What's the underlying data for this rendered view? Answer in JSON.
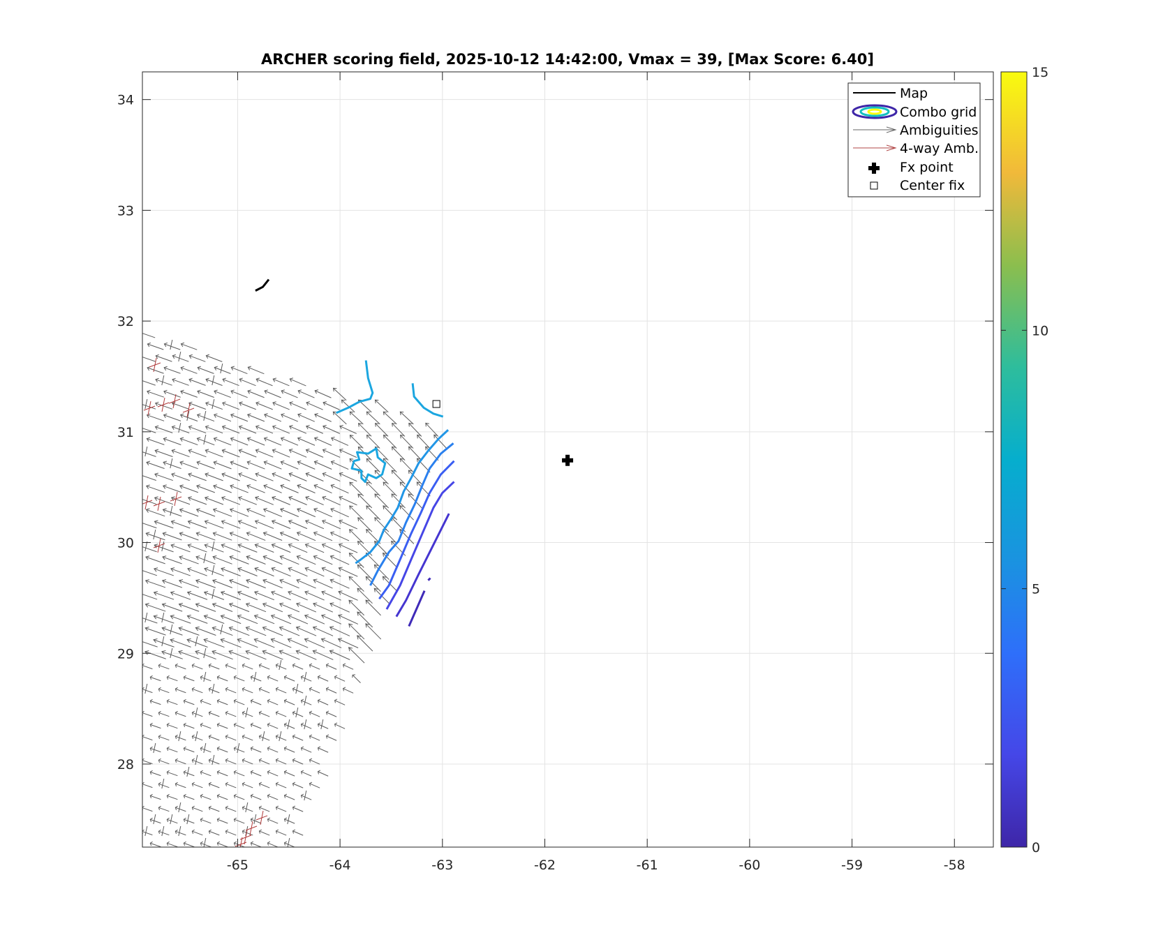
{
  "chart_data": {
    "type": "contour",
    "title": "ARCHER scoring field, 2025-10-12 14:42:00, Vmax = 39, [Max Score: 6.40]",
    "xlabel": "",
    "ylabel": "",
    "xlim": [
      -65.93,
      -57.62
    ],
    "ylim": [
      27.25,
      34.25
    ],
    "grid": true,
    "xticks": [
      -65,
      -64,
      -63,
      -62,
      -61,
      -60,
      -59,
      -58
    ],
    "yticks": [
      28,
      29,
      30,
      31,
      32,
      33,
      34
    ],
    "colorbar": {
      "min": 0,
      "max": 15,
      "ticks": [
        0,
        5,
        10,
        15
      ],
      "colormap": "parula"
    },
    "legend": {
      "placement": "top-right",
      "entries": [
        "Map",
        "Combo grid",
        "Ambiguities",
        "4-way Amb.",
        "Fx point",
        "Center fix"
      ]
    },
    "map_coast": [
      [
        -64.826,
        32.274
      ],
      [
        -64.754,
        32.308
      ],
      [
        -64.696,
        32.375
      ]
    ],
    "fx_point": {
      "lon": -61.778,
      "lat": 30.742
    },
    "center_fix": {
      "lon": -63.059,
      "lat": 31.251
    },
    "contours": [
      {
        "level": 5.8,
        "color": "#1ba6e0",
        "points": [
          [
            -63.747,
            31.645
          ],
          [
            -63.726,
            31.485
          ],
          [
            -63.682,
            31.351
          ],
          [
            -63.704,
            31.298
          ],
          [
            -63.812,
            31.271
          ],
          [
            -63.921,
            31.217
          ],
          [
            -64.037,
            31.171
          ]
        ]
      },
      {
        "level": 5.8,
        "color": "#1ba6e0",
        "points": [
          [
            -63.291,
            31.438
          ],
          [
            -63.277,
            31.318
          ],
          [
            -63.182,
            31.217
          ],
          [
            -63.088,
            31.164
          ],
          [
            -62.994,
            31.137
          ]
        ]
      },
      {
        "level": 5.8,
        "color": "#1ba6e0",
        "closed": true,
        "points": [
          [
            -63.834,
            30.816
          ],
          [
            -63.726,
            30.803
          ],
          [
            -63.646,
            30.849
          ],
          [
            -63.631,
            30.769
          ],
          [
            -63.559,
            30.716
          ],
          [
            -63.588,
            30.615
          ],
          [
            -63.646,
            30.582
          ],
          [
            -63.726,
            30.615
          ],
          [
            -63.755,
            30.548
          ],
          [
            -63.791,
            30.582
          ],
          [
            -63.791,
            30.649
          ],
          [
            -63.885,
            30.669
          ],
          [
            -63.863,
            30.736
          ],
          [
            -63.812,
            30.749
          ]
        ]
      },
      {
        "level": 5.2,
        "color": "#2196e6",
        "points": [
          [
            -62.944,
            31.017
          ],
          [
            -63.038,
            30.936
          ],
          [
            -63.139,
            30.829
          ],
          [
            -63.233,
            30.716
          ],
          [
            -63.306,
            30.582
          ],
          [
            -63.378,
            30.462
          ],
          [
            -63.436,
            30.314
          ],
          [
            -63.501,
            30.214
          ],
          [
            -63.573,
            30.114
          ],
          [
            -63.617,
            30.013
          ],
          [
            -63.704,
            29.913
          ],
          [
            -63.798,
            29.846
          ],
          [
            -63.849,
            29.813
          ]
        ]
      },
      {
        "level": 4.6,
        "color": "#2a80ee",
        "points": [
          [
            -62.893,
            30.896
          ],
          [
            -63.016,
            30.803
          ],
          [
            -63.125,
            30.669
          ],
          [
            -63.197,
            30.515
          ],
          [
            -63.269,
            30.348
          ],
          [
            -63.356,
            30.181
          ],
          [
            -63.429,
            30.013
          ],
          [
            -63.523,
            29.913
          ],
          [
            -63.631,
            29.746
          ],
          [
            -63.704,
            29.612
          ]
        ]
      },
      {
        "level": 3.5,
        "color": "#3a5ef2",
        "points": [
          [
            -62.886,
            30.736
          ],
          [
            -63.016,
            30.615
          ],
          [
            -63.125,
            30.448
          ],
          [
            -63.211,
            30.268
          ],
          [
            -63.306,
            30.08
          ],
          [
            -63.414,
            29.846
          ],
          [
            -63.523,
            29.612
          ],
          [
            -63.617,
            29.492
          ]
        ]
      },
      {
        "level": 2.3,
        "color": "#4646e6",
        "points": [
          [
            -62.886,
            30.549
          ],
          [
            -63.001,
            30.448
          ],
          [
            -63.088,
            30.314
          ],
          [
            -63.197,
            30.08
          ],
          [
            -63.306,
            29.846
          ],
          [
            -63.414,
            29.612
          ],
          [
            -63.545,
            29.398
          ]
        ]
      },
      {
        "level": 1.2,
        "color": "#4535d0",
        "points": [
          [
            -62.936,
            30.261
          ],
          [
            -63.088,
            29.98
          ],
          [
            -63.233,
            29.712
          ],
          [
            -63.356,
            29.478
          ],
          [
            -63.45,
            29.331
          ]
        ]
      },
      {
        "level": 0.6,
        "color": "#3f2ab8",
        "points": [
          [
            -63.175,
            29.565
          ],
          [
            -63.327,
            29.244
          ]
        ]
      },
      {
        "level": 0.6,
        "color": "#3f2ab8",
        "points": [
          [
            -63.139,
            29.659
          ],
          [
            -63.118,
            29.679
          ]
        ]
      }
    ]
  }
}
